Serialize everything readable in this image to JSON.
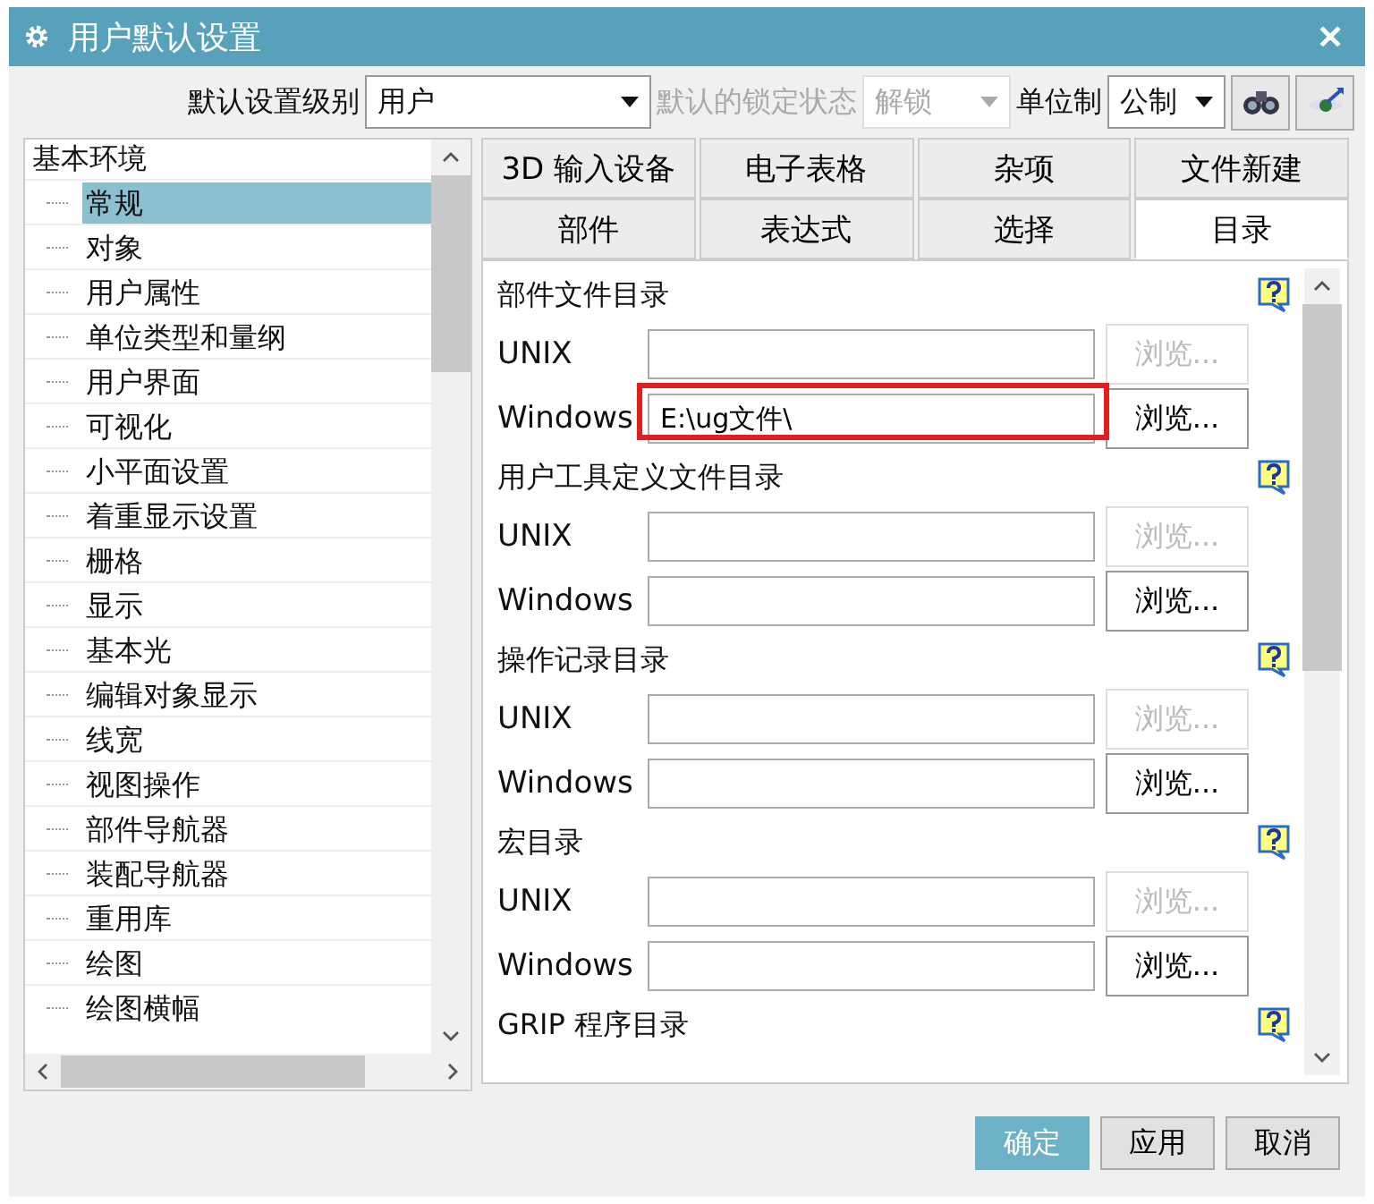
{
  "window": {
    "title": "用户默认设置",
    "close": "✕"
  },
  "toolbar": {
    "level_label": "默认设置级别",
    "level_value": "用户",
    "lock_label": "默认的锁定状态",
    "lock_value": "解锁",
    "lock_disabled": true,
    "unit_label": "单位制",
    "unit_value": "公制"
  },
  "tree": {
    "label": "基本环境",
    "children": [
      {
        "label": "常规",
        "selected": true
      },
      {
        "label": "对象",
        "selected": false
      },
      {
        "label": "用户属性",
        "selected": false
      },
      {
        "label": "单位类型和量纲",
        "selected": false
      },
      {
        "label": "用户界面",
        "selected": false
      },
      {
        "label": "可视化",
        "selected": false
      },
      {
        "label": "小平面设置",
        "selected": false
      },
      {
        "label": "着重显示设置",
        "selected": false
      },
      {
        "label": "栅格",
        "selected": false
      },
      {
        "label": "显示",
        "selected": false
      },
      {
        "label": "基本光",
        "selected": false
      },
      {
        "label": "编辑对象显示",
        "selected": false
      },
      {
        "label": "线宽",
        "selected": false
      },
      {
        "label": "视图操作",
        "selected": false
      },
      {
        "label": "部件导航器",
        "selected": false
      },
      {
        "label": "装配导航器",
        "selected": false
      },
      {
        "label": "重用库",
        "selected": false
      },
      {
        "label": "绘图",
        "selected": false
      },
      {
        "label": "绘图横幅",
        "selected": false
      }
    ]
  },
  "tab_rows": [
    [
      {
        "label": "3D 输入设备",
        "selected": false
      },
      {
        "label": "电子表格",
        "selected": false
      },
      {
        "label": "杂项",
        "selected": false
      },
      {
        "label": "文件新建",
        "selected": false
      }
    ],
    [
      {
        "label": "部件",
        "selected": false
      },
      {
        "label": "表达式",
        "selected": false
      },
      {
        "label": "选择",
        "selected": false
      },
      {
        "label": "目录",
        "selected": true
      }
    ]
  ],
  "sections": [
    {
      "title": "部件文件目录",
      "rows": [
        {
          "label": "UNIX",
          "value": "",
          "browse": "浏览...",
          "disabled": true,
          "highlighted": false
        },
        {
          "label": "Windows",
          "value": "E:\\ug文件\\",
          "browse": "浏览...",
          "disabled": false,
          "highlighted": true
        }
      ]
    },
    {
      "title": "用户工具定义文件目录",
      "rows": [
        {
          "label": "UNIX",
          "value": "",
          "browse": "浏览...",
          "disabled": true,
          "highlighted": false
        },
        {
          "label": "Windows",
          "value": "",
          "browse": "浏览...",
          "disabled": false,
          "highlighted": false
        }
      ]
    },
    {
      "title": "操作记录目录",
      "rows": [
        {
          "label": "UNIX",
          "value": "",
          "browse": "浏览...",
          "disabled": true,
          "highlighted": false
        },
        {
          "label": "Windows",
          "value": "",
          "browse": "浏览...",
          "disabled": false,
          "highlighted": false
        }
      ]
    },
    {
      "title": "宏目录",
      "rows": [
        {
          "label": "UNIX",
          "value": "",
          "browse": "浏览...",
          "disabled": true,
          "highlighted": false
        },
        {
          "label": "Windows",
          "value": "",
          "browse": "浏览...",
          "disabled": false,
          "highlighted": false
        }
      ]
    },
    {
      "title": "GRIP 程序目录"
    }
  ],
  "buttons": [
    {
      "label": "确定",
      "kind": "primary"
    },
    {
      "label": "应用",
      "kind": "normal"
    },
    {
      "label": "取消",
      "kind": "normal"
    }
  ]
}
